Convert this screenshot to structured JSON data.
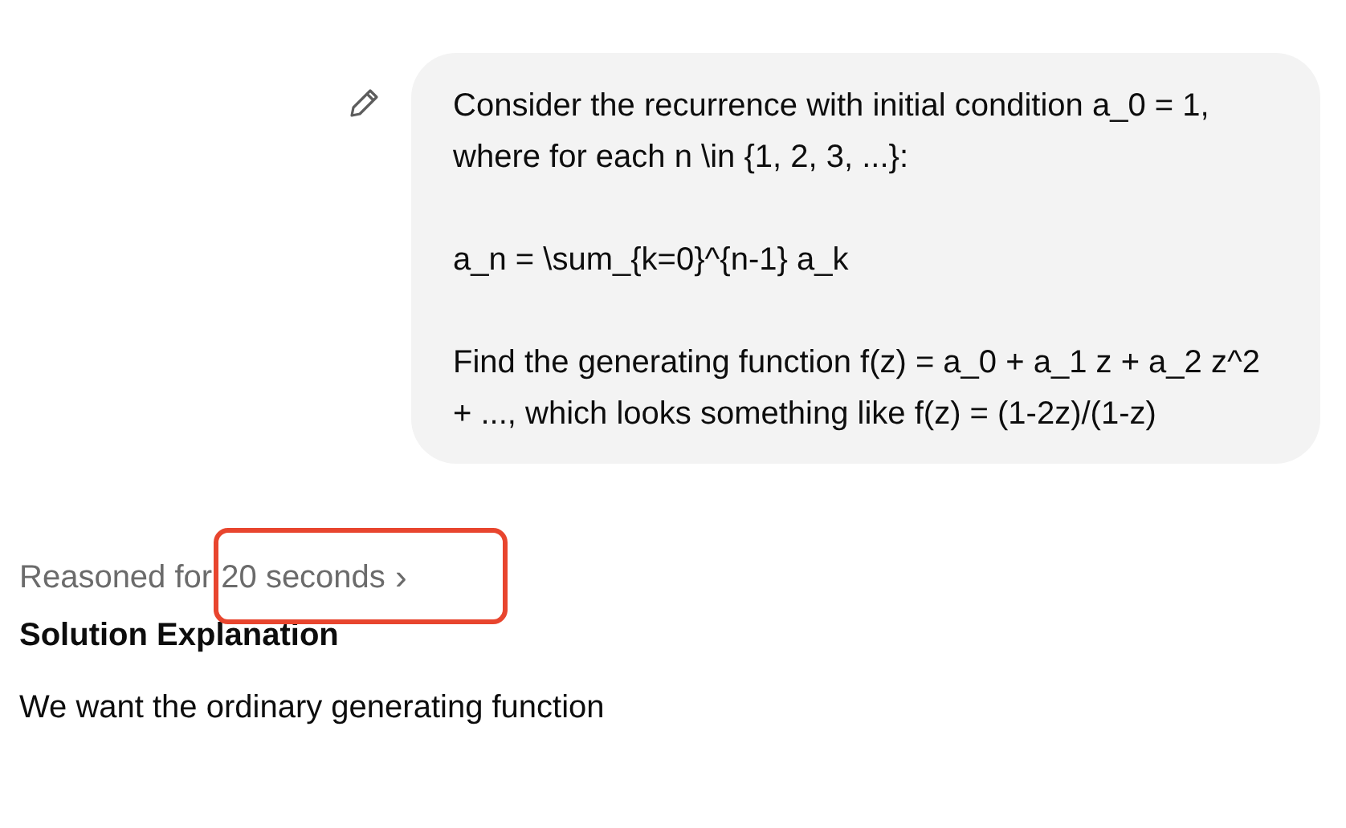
{
  "user_message": {
    "paragraphs": [
      "Consider the recurrence with initial condition a_0 = 1, where for each n \\in {1, 2, 3, ...}:",
      "a_n = \\sum_{k=0}^{n-1} a_k",
      "Find the generating function f(z) = a_0 + a_1 z + a_2 z^2 + ..., which looks something like f(z) = (1-2z)/(1-z)"
    ]
  },
  "reasoning": {
    "label": "Reasoned for 20 seconds",
    "chevron": "›",
    "highlighted": true
  },
  "answer": {
    "heading": "Solution Explanation",
    "text": "We want the ordinary generating function"
  }
}
